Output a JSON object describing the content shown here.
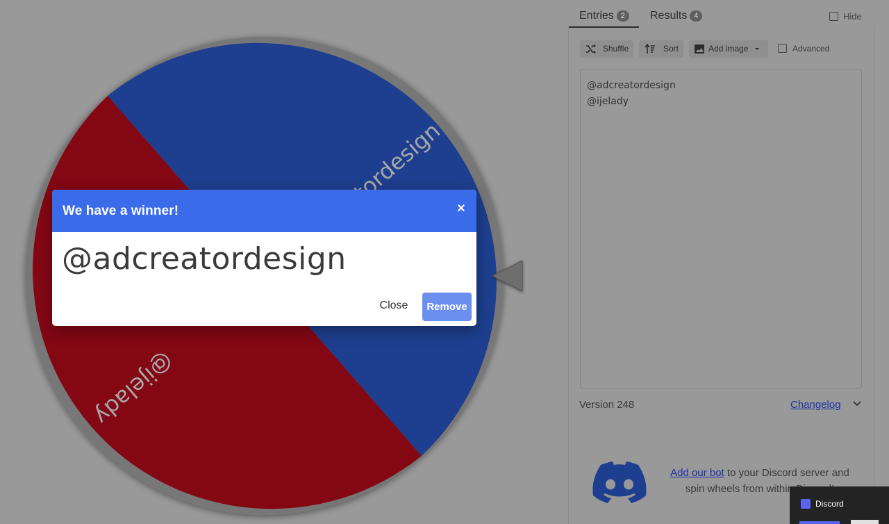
{
  "wheel": {
    "entries": [
      {
        "label": "@adcreatordesign",
        "color": "#1e3f8f"
      },
      {
        "label": "@ijelady",
        "color": "#840714"
      }
    ],
    "pointer_color": "#6e6e6e"
  },
  "modal": {
    "title": "We have a winner!",
    "close_icon": "×",
    "winner": "@adcreatordesign",
    "close_label": "Close",
    "remove_label": "Remove",
    "header_color": "#3a6be8"
  },
  "tabs": [
    {
      "label": "Entries",
      "count": "2",
      "active": true
    },
    {
      "label": "Results",
      "count": "4",
      "active": false
    }
  ],
  "hide_label": "Hide",
  "toolbar": {
    "shuffle_label": "Shuffle",
    "sort_label": "Sort",
    "add_image_label": "Add image",
    "advanced_label": "Advanced"
  },
  "entries_text": [
    "@adcreatordesign",
    "@ijelady"
  ],
  "version": "Version 248",
  "changelog_label": "Changelog",
  "discord": {
    "link_text": "Add our bot",
    "text": "to your Discord server and spin wheels from within Discord!"
  },
  "discord_popup": {
    "title": "Discord"
  }
}
